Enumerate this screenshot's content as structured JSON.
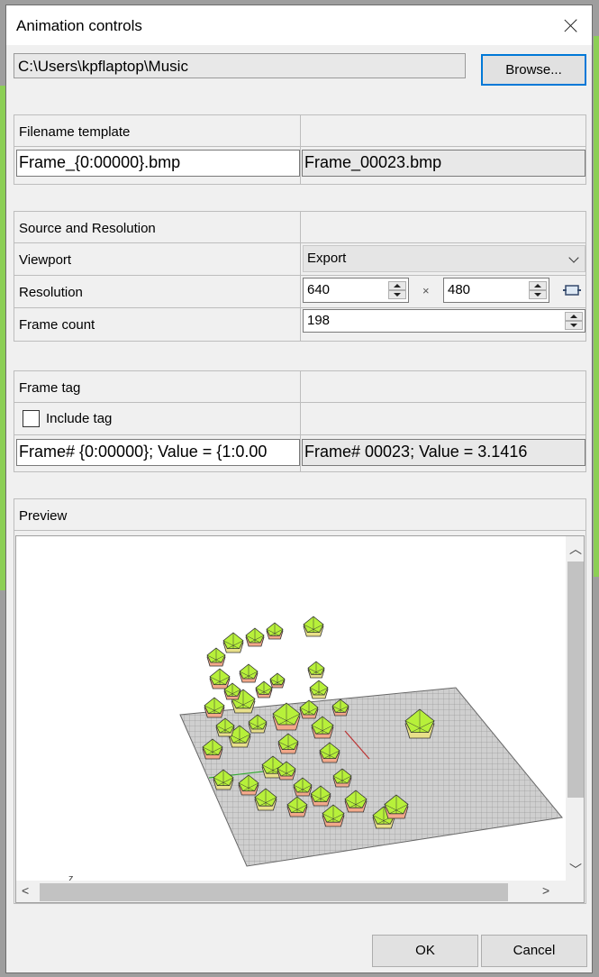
{
  "window": {
    "title": "Animation controls"
  },
  "folder": {
    "path": "C:\\Users\\kpflaptop\\Music",
    "browse_label": "Browse..."
  },
  "filename": {
    "header": "Filename template",
    "template": "Frame_{0:00000}.bmp",
    "preview": "Frame_00023.bmp"
  },
  "source": {
    "header": "Source and Resolution",
    "viewport_label": "Viewport",
    "viewport_value": "Export",
    "resolution_label": "Resolution",
    "width": "640",
    "times": "×",
    "height": "480",
    "frame_count_label": "Frame count",
    "frame_count": "198"
  },
  "tag": {
    "header": "Frame tag",
    "include_label": "Include tag",
    "include_checked": false,
    "template": "Frame# {0:00000};   Value = {1:0.00",
    "preview": "Frame# 00023;   Value = 3.1416"
  },
  "preview": {
    "header": "Preview",
    "axis_label": "z"
  },
  "buttons": {
    "ok": "OK",
    "cancel": "Cancel"
  },
  "colors": {
    "accent": "#0078d7",
    "shape_green": "#b7f03a",
    "shape_tan": "#e8df8a",
    "shape_pink": "#f2a88a"
  }
}
